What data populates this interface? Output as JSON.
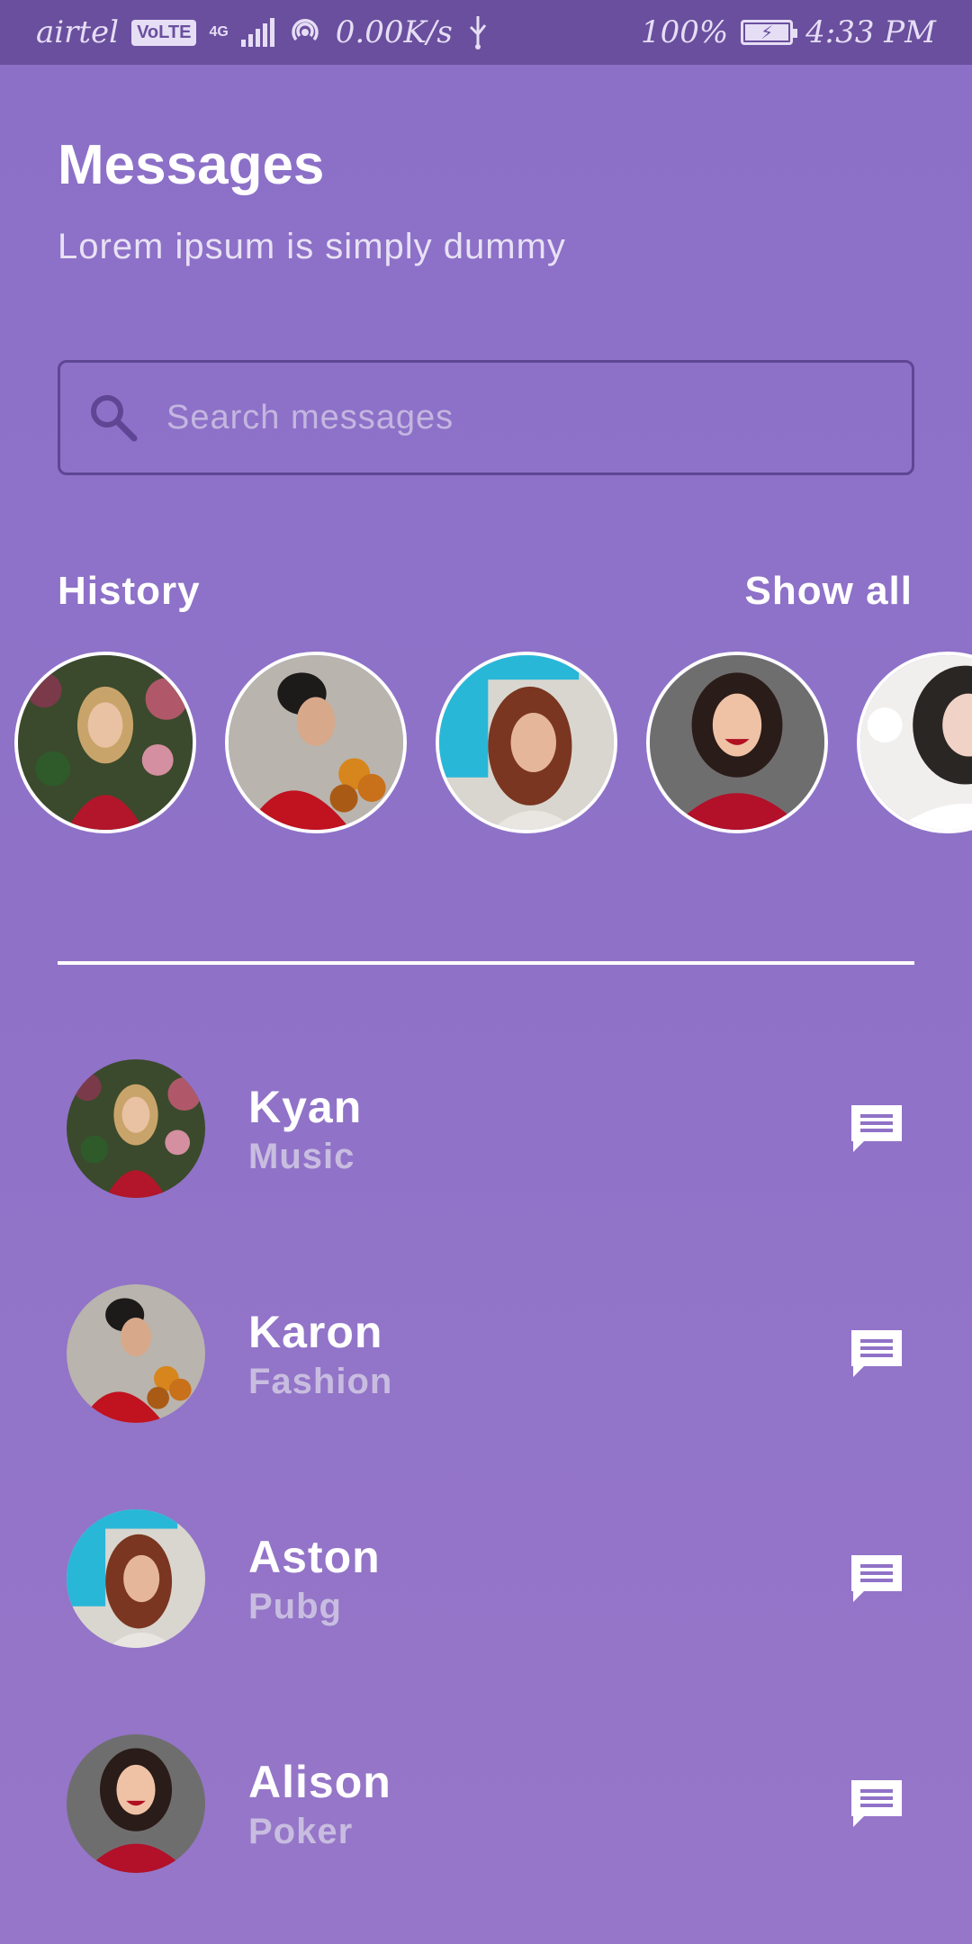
{
  "status_bar": {
    "carrier": "airtel",
    "volte": "VoLTE",
    "network": "4G",
    "speed": "0.00K/s",
    "battery": "100%",
    "time": "4:33 PM"
  },
  "header": {
    "title": "Messages",
    "subtitle": "Lorem ipsum is simply dummy"
  },
  "search": {
    "placeholder": "Search messages"
  },
  "history": {
    "label": "History",
    "show_all": "Show all"
  },
  "contacts": [
    {
      "name": "Kyan",
      "category": "Music"
    },
    {
      "name": "Karon",
      "category": "Fashion"
    },
    {
      "name": "Aston",
      "category": "Pubg"
    },
    {
      "name": "Alison",
      "category": "Poker"
    }
  ],
  "colors": {
    "background": "#8f72c8",
    "status_bar": "#6a4f9e",
    "accent": "#ffffff",
    "secondary_text": "#c8bde0"
  }
}
